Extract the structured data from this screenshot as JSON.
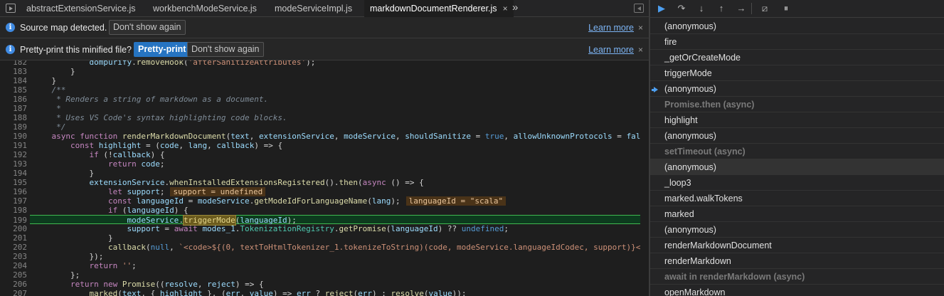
{
  "tabs": [
    {
      "label": "abstractExtensionService.js",
      "active": false
    },
    {
      "label": "workbenchModeService.js",
      "active": false
    },
    {
      "label": "modeServiceImpl.js",
      "active": false
    },
    {
      "label": "markdownDocumentRenderer.js",
      "active": true
    }
  ],
  "tab_close": "×",
  "more_tabs": "»",
  "infobar1": {
    "text": "Source map detected.",
    "dont_show": "Don't show again",
    "learn_more": "Learn more",
    "close": "×"
  },
  "infobar2": {
    "text": "Pretty-print this minified file?",
    "pretty_print": "Pretty-print",
    "dont_show": "Don't show again",
    "learn_more": "Learn more",
    "close": "×"
  },
  "code": {
    "first_line": 182,
    "current_line": 199,
    "lines": [
      "            dompurify.removeHook('afterSanitizeAttributes');",
      "        }",
      "    }",
      "    /**",
      "     * Renders a string of markdown as a document.",
      "     *",
      "     * Uses VS Code's syntax highlighting code blocks.",
      "     */",
      "    async function renderMarkdownDocument(text, extensionService, modeService, shouldSanitize = true, allowUnknownProtocols = fal",
      "        const highlight = (code, lang, callback) => {",
      "            if (!callback) {",
      "                return code;",
      "            }",
      "            extensionService.whenInstalledExtensionsRegistered().then(async () => {",
      "                let support;",
      "                const languageId = modeService.getModeIdForLanguageName(lang);",
      "                if (languageId) {",
      "                    modeService.triggerMode(languageId);",
      "                    support = await modes_1.TokenizationRegistry.getPromise(languageId) ?? undefined;",
      "                }",
      "                callback(null, `<code>${(0, textToHtmlTokenizer_1.tokenizeToString)(code, modeService.languageIdCodec, support)}<",
      "            });",
      "            return '';",
      "        };",
      "        return new Promise((resolve, reject) => {",
      "            marked(text, { highlight }, (err, value) => err ? reject(err) : resolve(value));"
    ],
    "inline_values": {
      "support": "support = undefined",
      "languageId": "languageId = \"scala\""
    }
  },
  "debugger": {
    "toolbar": [
      {
        "name": "resume-icon",
        "glyph": "▶"
      },
      {
        "name": "step-over-icon",
        "glyph": "↷"
      },
      {
        "name": "step-into-icon",
        "glyph": "↓"
      },
      {
        "name": "step-out-icon",
        "glyph": "↑"
      },
      {
        "name": "step-icon",
        "glyph": "→"
      },
      {
        "name": "deactivate-breakpoints-icon",
        "glyph": "⧄"
      },
      {
        "name": "pause-on-exceptions-icon",
        "glyph": "⏸"
      }
    ],
    "frames": [
      {
        "label": "(anonymous)",
        "type": "frame"
      },
      {
        "label": "fire",
        "type": "frame"
      },
      {
        "label": "_getOrCreateMode",
        "type": "frame"
      },
      {
        "label": "triggerMode",
        "type": "frame"
      },
      {
        "label": "(anonymous)",
        "type": "current"
      },
      {
        "label": "Promise.then (async)",
        "type": "async"
      },
      {
        "label": "highlight",
        "type": "frame"
      },
      {
        "label": "(anonymous)",
        "type": "frame"
      },
      {
        "label": "setTimeout (async)",
        "type": "async"
      },
      {
        "label": "(anonymous)",
        "type": "selected"
      },
      {
        "label": "_loop3",
        "type": "frame"
      },
      {
        "label": "marked.walkTokens",
        "type": "frame"
      },
      {
        "label": "marked",
        "type": "frame"
      },
      {
        "label": "(anonymous)",
        "type": "frame"
      },
      {
        "label": "renderMarkdownDocument",
        "type": "frame"
      },
      {
        "label": "renderMarkdown",
        "type": "frame"
      },
      {
        "label": "await in renderMarkdown (async)",
        "type": "async"
      },
      {
        "label": "openMarkdown",
        "type": "frame"
      }
    ]
  },
  "colors": {
    "accent": "#2674c2",
    "current_line": "#0d3b1e",
    "current_line_border": "#3fb950",
    "frame_marker": "#4d9ff0"
  }
}
